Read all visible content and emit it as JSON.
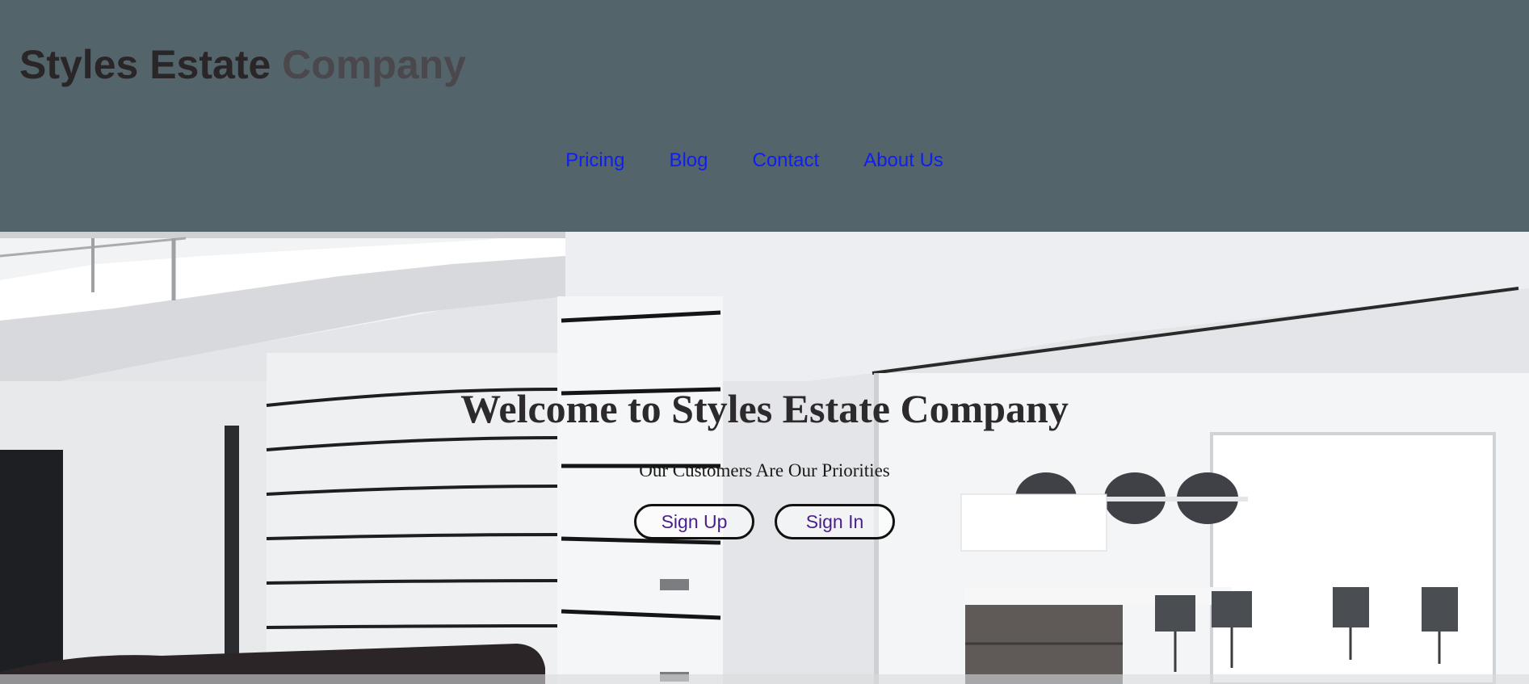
{
  "header": {
    "logo_part1": "Styles Estate ",
    "logo_part2": "Company",
    "nav": [
      "Pricing",
      "Blog",
      "Contact",
      "About Us"
    ]
  },
  "hero": {
    "title": "Welcome to Styles Estate Company",
    "subtitle": "Our Customers Are Our Priorities",
    "buttons": [
      "Sign Up",
      "Sign In"
    ]
  },
  "colors": {
    "header_bg": "#53646b",
    "nav_link": "#0f1ff0",
    "button_text": "#4b1f8a"
  }
}
